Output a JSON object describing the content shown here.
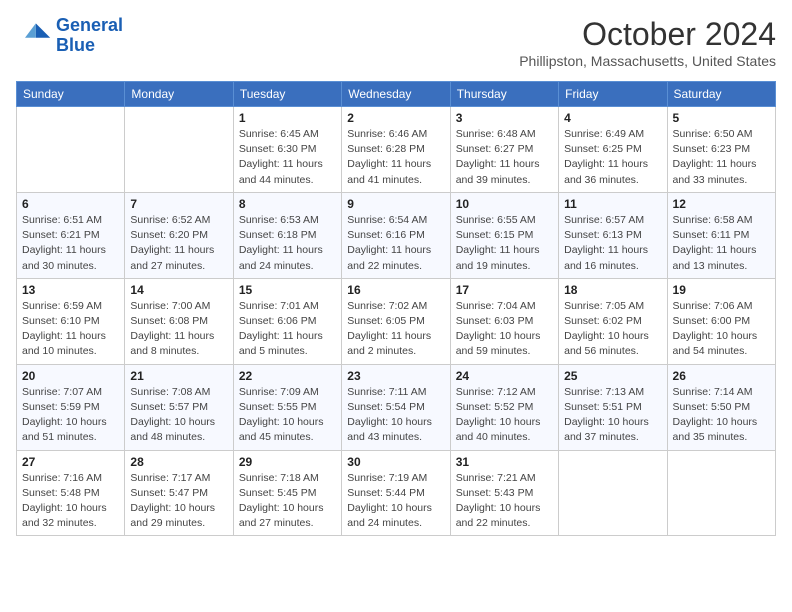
{
  "logo": {
    "line1": "General",
    "line2": "Blue"
  },
  "header": {
    "month": "October 2024",
    "location": "Phillipston, Massachusetts, United States"
  },
  "days_of_week": [
    "Sunday",
    "Monday",
    "Tuesday",
    "Wednesday",
    "Thursday",
    "Friday",
    "Saturday"
  ],
  "weeks": [
    [
      {
        "day": "",
        "info": ""
      },
      {
        "day": "",
        "info": ""
      },
      {
        "day": "1",
        "info": "Sunrise: 6:45 AM\nSunset: 6:30 PM\nDaylight: 11 hours and 44 minutes."
      },
      {
        "day": "2",
        "info": "Sunrise: 6:46 AM\nSunset: 6:28 PM\nDaylight: 11 hours and 41 minutes."
      },
      {
        "day": "3",
        "info": "Sunrise: 6:48 AM\nSunset: 6:27 PM\nDaylight: 11 hours and 39 minutes."
      },
      {
        "day": "4",
        "info": "Sunrise: 6:49 AM\nSunset: 6:25 PM\nDaylight: 11 hours and 36 minutes."
      },
      {
        "day": "5",
        "info": "Sunrise: 6:50 AM\nSunset: 6:23 PM\nDaylight: 11 hours and 33 minutes."
      }
    ],
    [
      {
        "day": "6",
        "info": "Sunrise: 6:51 AM\nSunset: 6:21 PM\nDaylight: 11 hours and 30 minutes."
      },
      {
        "day": "7",
        "info": "Sunrise: 6:52 AM\nSunset: 6:20 PM\nDaylight: 11 hours and 27 minutes."
      },
      {
        "day": "8",
        "info": "Sunrise: 6:53 AM\nSunset: 6:18 PM\nDaylight: 11 hours and 24 minutes."
      },
      {
        "day": "9",
        "info": "Sunrise: 6:54 AM\nSunset: 6:16 PM\nDaylight: 11 hours and 22 minutes."
      },
      {
        "day": "10",
        "info": "Sunrise: 6:55 AM\nSunset: 6:15 PM\nDaylight: 11 hours and 19 minutes."
      },
      {
        "day": "11",
        "info": "Sunrise: 6:57 AM\nSunset: 6:13 PM\nDaylight: 11 hours and 16 minutes."
      },
      {
        "day": "12",
        "info": "Sunrise: 6:58 AM\nSunset: 6:11 PM\nDaylight: 11 hours and 13 minutes."
      }
    ],
    [
      {
        "day": "13",
        "info": "Sunrise: 6:59 AM\nSunset: 6:10 PM\nDaylight: 11 hours and 10 minutes."
      },
      {
        "day": "14",
        "info": "Sunrise: 7:00 AM\nSunset: 6:08 PM\nDaylight: 11 hours and 8 minutes."
      },
      {
        "day": "15",
        "info": "Sunrise: 7:01 AM\nSunset: 6:06 PM\nDaylight: 11 hours and 5 minutes."
      },
      {
        "day": "16",
        "info": "Sunrise: 7:02 AM\nSunset: 6:05 PM\nDaylight: 11 hours and 2 minutes."
      },
      {
        "day": "17",
        "info": "Sunrise: 7:04 AM\nSunset: 6:03 PM\nDaylight: 10 hours and 59 minutes."
      },
      {
        "day": "18",
        "info": "Sunrise: 7:05 AM\nSunset: 6:02 PM\nDaylight: 10 hours and 56 minutes."
      },
      {
        "day": "19",
        "info": "Sunrise: 7:06 AM\nSunset: 6:00 PM\nDaylight: 10 hours and 54 minutes."
      }
    ],
    [
      {
        "day": "20",
        "info": "Sunrise: 7:07 AM\nSunset: 5:59 PM\nDaylight: 10 hours and 51 minutes."
      },
      {
        "day": "21",
        "info": "Sunrise: 7:08 AM\nSunset: 5:57 PM\nDaylight: 10 hours and 48 minutes."
      },
      {
        "day": "22",
        "info": "Sunrise: 7:09 AM\nSunset: 5:55 PM\nDaylight: 10 hours and 45 minutes."
      },
      {
        "day": "23",
        "info": "Sunrise: 7:11 AM\nSunset: 5:54 PM\nDaylight: 10 hours and 43 minutes."
      },
      {
        "day": "24",
        "info": "Sunrise: 7:12 AM\nSunset: 5:52 PM\nDaylight: 10 hours and 40 minutes."
      },
      {
        "day": "25",
        "info": "Sunrise: 7:13 AM\nSunset: 5:51 PM\nDaylight: 10 hours and 37 minutes."
      },
      {
        "day": "26",
        "info": "Sunrise: 7:14 AM\nSunset: 5:50 PM\nDaylight: 10 hours and 35 minutes."
      }
    ],
    [
      {
        "day": "27",
        "info": "Sunrise: 7:16 AM\nSunset: 5:48 PM\nDaylight: 10 hours and 32 minutes."
      },
      {
        "day": "28",
        "info": "Sunrise: 7:17 AM\nSunset: 5:47 PM\nDaylight: 10 hours and 29 minutes."
      },
      {
        "day": "29",
        "info": "Sunrise: 7:18 AM\nSunset: 5:45 PM\nDaylight: 10 hours and 27 minutes."
      },
      {
        "day": "30",
        "info": "Sunrise: 7:19 AM\nSunset: 5:44 PM\nDaylight: 10 hours and 24 minutes."
      },
      {
        "day": "31",
        "info": "Sunrise: 7:21 AM\nSunset: 5:43 PM\nDaylight: 10 hours and 22 minutes."
      },
      {
        "day": "",
        "info": ""
      },
      {
        "day": "",
        "info": ""
      }
    ]
  ]
}
